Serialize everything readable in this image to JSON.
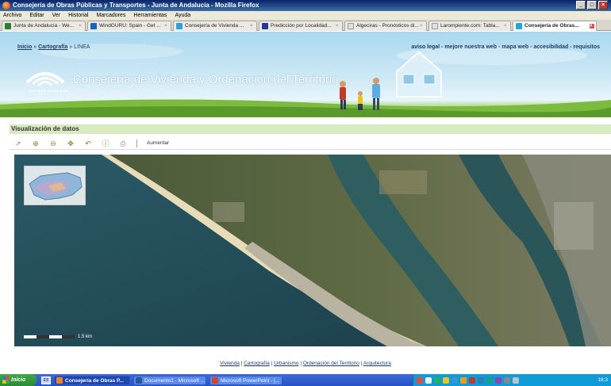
{
  "window": {
    "title": "Consejería de Obras Públicas y Transportes - Junta de Andalucía - Mozilla Firefox",
    "buttons": [
      "_",
      "□",
      "×"
    ]
  },
  "menubar": [
    "Archivo",
    "Editar",
    "Ver",
    "Historial",
    "Marcadores",
    "Herramientas",
    "Ayuda"
  ],
  "tabs": [
    {
      "label": "Junta de Andalucía - We...",
      "icon_color": "#2e7d32"
    },
    {
      "label": "WindGURU: Spain - Get ...",
      "icon_color": "#1565c0"
    },
    {
      "label": "Consejería de Vivienda ...",
      "icon_color": "#29a3d8"
    },
    {
      "label": "Predicción por Localidad...",
      "icon_color": "#283593"
    },
    {
      "label": "Algeciras - Pronósticos di...",
      "icon_color": "#9e9e9e"
    },
    {
      "label": "Larompiente.com: Tabla...",
      "icon_color": "#9e9e9e"
    },
    {
      "label": "Consejería de Obras...",
      "icon_color": "#29a3d8",
      "active": true
    }
  ],
  "header": {
    "breadcrumb_home": "Inicio",
    "breadcrumb_sep": "»",
    "breadcrumb_cartografia": "Cartografía",
    "breadcrumb_current": "LINEA",
    "top_links": "aviso legal - mejore nuestra web - mapa web - accesibilidad - requisitos",
    "logo_text": "JUNTA DE ANDALUCIA",
    "site_title": "Consejería de Vivienda y Ordenación del Territorio"
  },
  "section_title": "Visualización de datos",
  "toolbar": {
    "tools": [
      "pointer-icon",
      "zoom-in-icon",
      "zoom-out-icon",
      "pan-icon",
      "back-icon",
      "info-icon",
      "print-icon"
    ],
    "aumentar_label": "Aumentar"
  },
  "map": {
    "scale_label": "1.5 km"
  },
  "footer": {
    "links": [
      "Vivienda",
      "Cartografía",
      "Urbanismo",
      "Ordenación del Territorio",
      "Arquitectura"
    ],
    "separator": "|"
  },
  "taskbar": {
    "start_label": "Inicio",
    "quick_launch": "ES",
    "tasks": [
      {
        "label": "Consejería de Obras P...",
        "icon_color": "#ff7f27",
        "active": true
      },
      {
        "label": "Documento1 - Microsoft ...",
        "icon_color": "#2b5797"
      },
      {
        "label": "Microsoft PowerPoint - [...",
        "icon_color": "#d24726"
      }
    ],
    "clock": "18:3"
  },
  "colors": {
    "accent_green": "#6fae35",
    "section_bg": "#d8eac0",
    "link_blue": "#1f3e63"
  }
}
